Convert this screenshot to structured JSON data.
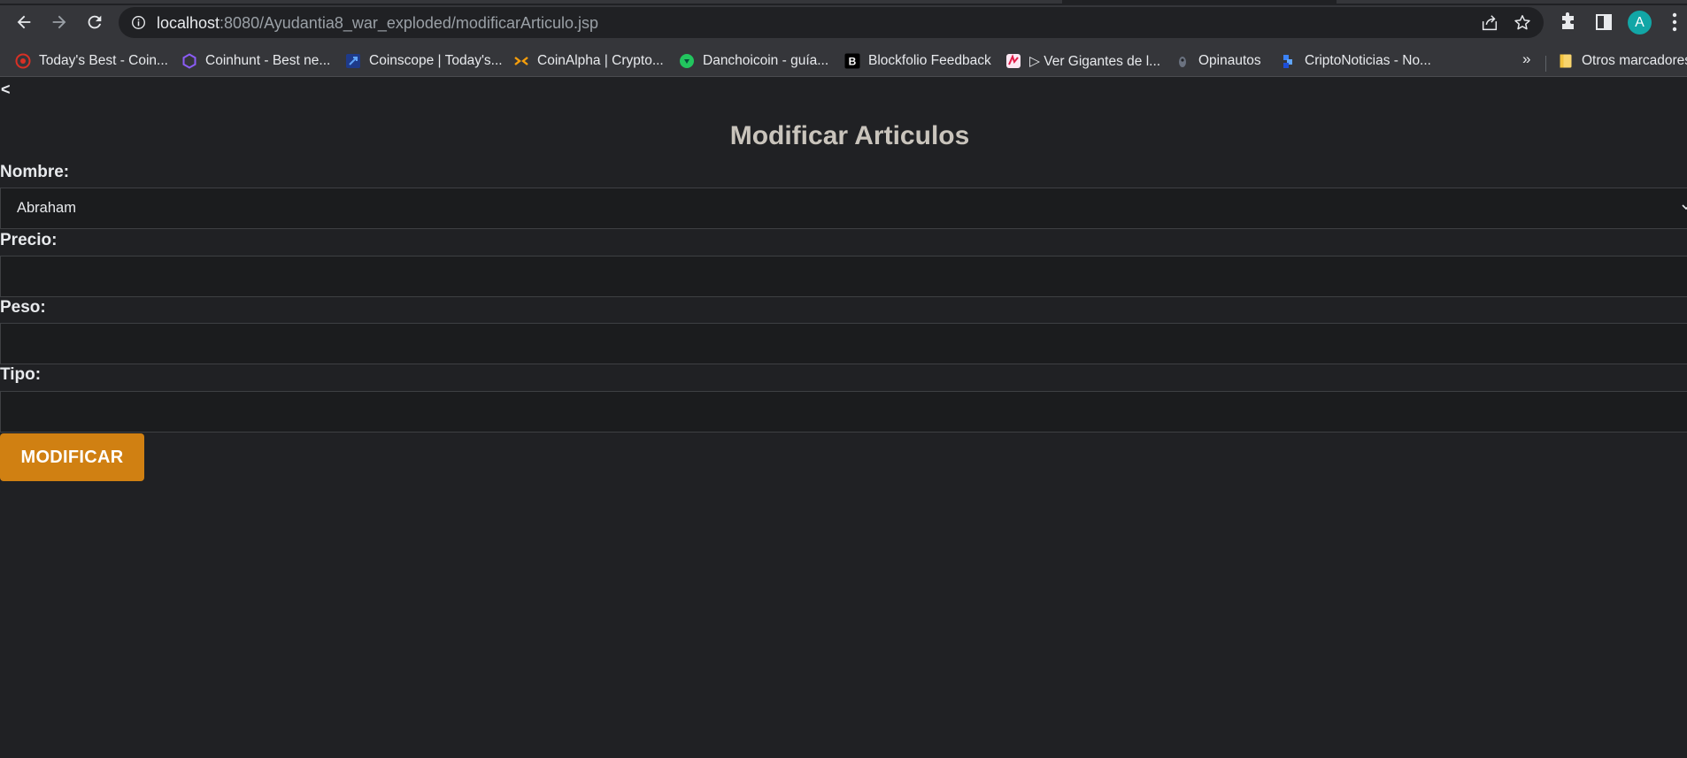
{
  "browser": {
    "url_host": "localhost",
    "url_path": ":8080/Ayudantia8_war_exploded/modificarArticulo.jsp",
    "avatar_letter": "A",
    "avatar_color": "#12a6a6",
    "icons": {
      "back": "arrow-left-icon",
      "forward": "arrow-right-icon",
      "reload": "reload-icon",
      "site_info": "info-icon",
      "share": "share-icon",
      "bookmark": "star-icon",
      "extensions": "puzzle-icon",
      "side_panel": "side-panel-icon",
      "menu": "more-vertical-icon"
    }
  },
  "bookmarks": {
    "items": [
      {
        "label": "Today's Best - Coin...",
        "icon": "coin-red-icon",
        "color": "#d93025"
      },
      {
        "label": "Coinhunt - Best ne...",
        "icon": "hexagon-icon",
        "color": "#8b5cf6"
      },
      {
        "label": "Coinscope | Today's...",
        "icon": "coinscope-icon",
        "color": "#3b82f6"
      },
      {
        "label": "CoinAlpha | Crypto...",
        "icon": "coinalpha-icon",
        "color": "#f59e0b"
      },
      {
        "label": "Danchoicoin - guía...",
        "icon": "danchoicoin-icon",
        "color": "#22c55e"
      },
      {
        "label": "Blockfolio Feedback",
        "icon": "blockfolio-icon",
        "color": "#000000"
      },
      {
        "label": "▷ Ver Gigantes de l...",
        "icon": "gigantes-icon",
        "color": "#e11d48"
      },
      {
        "label": "Opinautos",
        "icon": "opinautos-icon",
        "color": "#6b7280"
      },
      {
        "label": "CriptoNoticias - No...",
        "icon": "criptonoticias-icon",
        "color": "#3b82f6"
      }
    ],
    "overflow": "»",
    "other_folder": "Otros marcadores",
    "other_folder_icon": "folder-icon",
    "folder_color": "#f9d56e"
  },
  "page": {
    "back": "<",
    "title": "Modificar Articulos",
    "form": {
      "nombre_label": "Nombre:",
      "nombre_value": "Abraham",
      "precio_label": "Precio:",
      "precio_value": "",
      "peso_label": "Peso:",
      "peso_value": "",
      "tipo_label": "Tipo:",
      "tipo_value": "",
      "submit_label": "MODIFICAR",
      "submit_color": "#d08012"
    }
  }
}
